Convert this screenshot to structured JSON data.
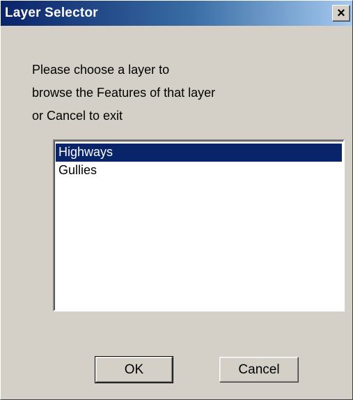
{
  "window": {
    "title": "Layer Selector",
    "close_label": "×"
  },
  "message": {
    "lines": [
      "Please choose a layer to",
      "browse the Features of that layer",
      "or Cancel to exit"
    ]
  },
  "layers": {
    "selected_index": 0,
    "items": [
      {
        "label": "Highways"
      },
      {
        "label": "Gullies"
      }
    ]
  },
  "buttons": {
    "ok_label": "OK",
    "cancel_label": "Cancel"
  },
  "colors": {
    "face": "#d4d0c8",
    "title_start": "#0a246a",
    "title_end": "#a6caf0",
    "selection": "#0a246a"
  }
}
